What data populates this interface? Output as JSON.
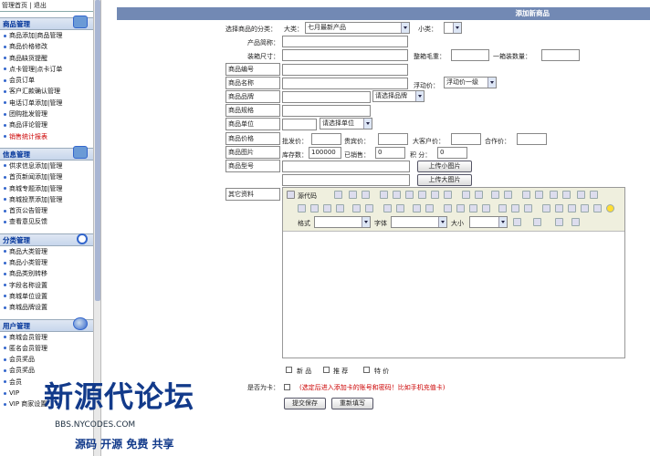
{
  "topnav": {
    "home": "管理首页",
    "sep": "|",
    "logout": "退出"
  },
  "sidebar": {
    "sections": [
      {
        "title": "商品管理",
        "items": [
          "商品添加|商品管理",
          "商品价格修改",
          "商品缺货提醒",
          "点卡管理|点卡订单",
          "会员订单",
          "客户汇款确认管理",
          "电话订单添加|管理",
          "团购批发管理",
          "商品评论管理",
          "销售统计报表"
        ]
      },
      {
        "title": "信息管理",
        "items": [
          "供求信息添加|管理",
          "首页新闻添加|管理",
          "商城专题添加|管理",
          "商城投票添加|管理",
          "首页公告管理",
          "查看意见反馈"
        ]
      },
      {
        "title": "分类管理",
        "items": [
          "商品大类管理",
          "商品小类管理",
          "商品类别转移",
          "字段名称设置",
          "商城单位设置",
          "商城品牌设置"
        ]
      },
      {
        "title": "用户管理",
        "items": [
          "商城会员管理",
          "匿名会员管理",
          "会员奖品",
          "会员奖品",
          "会员",
          "VIP",
          "VIP 商家设置"
        ]
      }
    ]
  },
  "header": {
    "title": "添加新商品"
  },
  "form": {
    "category_label": "选择商品的分类：",
    "big_label": "大类：",
    "big_value": "七月最新产品",
    "small_label": "小类：",
    "small_value": "",
    "abbr_label": "产品简称：",
    "size_label": "装箱尺寸：",
    "gross_label": "整箱毛重：",
    "qty_label": "一箱装数量：",
    "code_label": "商品编号",
    "name_label": "商品名称",
    "float_label": "浮动价：",
    "float_value": "浮动价一级",
    "brand_label": "商品品牌",
    "brand_select": "请选择品牌",
    "spec_label": "商品规格",
    "unit_label": "商品单位",
    "unit_select": "请选择单位",
    "price_label": "商品价格",
    "wholesale": "批发价：",
    "member": "贵宾价：",
    "bigcust": "大客户价：",
    "partner": "合作价：",
    "image_label": "商品图片",
    "stock": "库存数：",
    "stock_value": "100000",
    "sold": "已销售：",
    "sold_value": "0",
    "points": "积 分：",
    "points_value": "0",
    "model_label": "商品型号",
    "upload_small": "上传小图片",
    "upload_big": "上传大图片",
    "other_label": "其它资料",
    "source_btn": "源代码",
    "format_label": "格式",
    "font_label": "字体",
    "size_lbl": "大小",
    "new_label": "新 品",
    "rec_label": "推 荐",
    "special_label": "特 价",
    "card_label": "是否为卡：",
    "card_note": "(选定后进入添加卡的账号和密码！比如手机充值卡)",
    "submit": "提交保存",
    "reset": "重新填写"
  },
  "watermark": {
    "title": "新源代论坛",
    "url": "BBS.NYCODES.COM",
    "slogan": "源码 开源 免费 共享"
  }
}
